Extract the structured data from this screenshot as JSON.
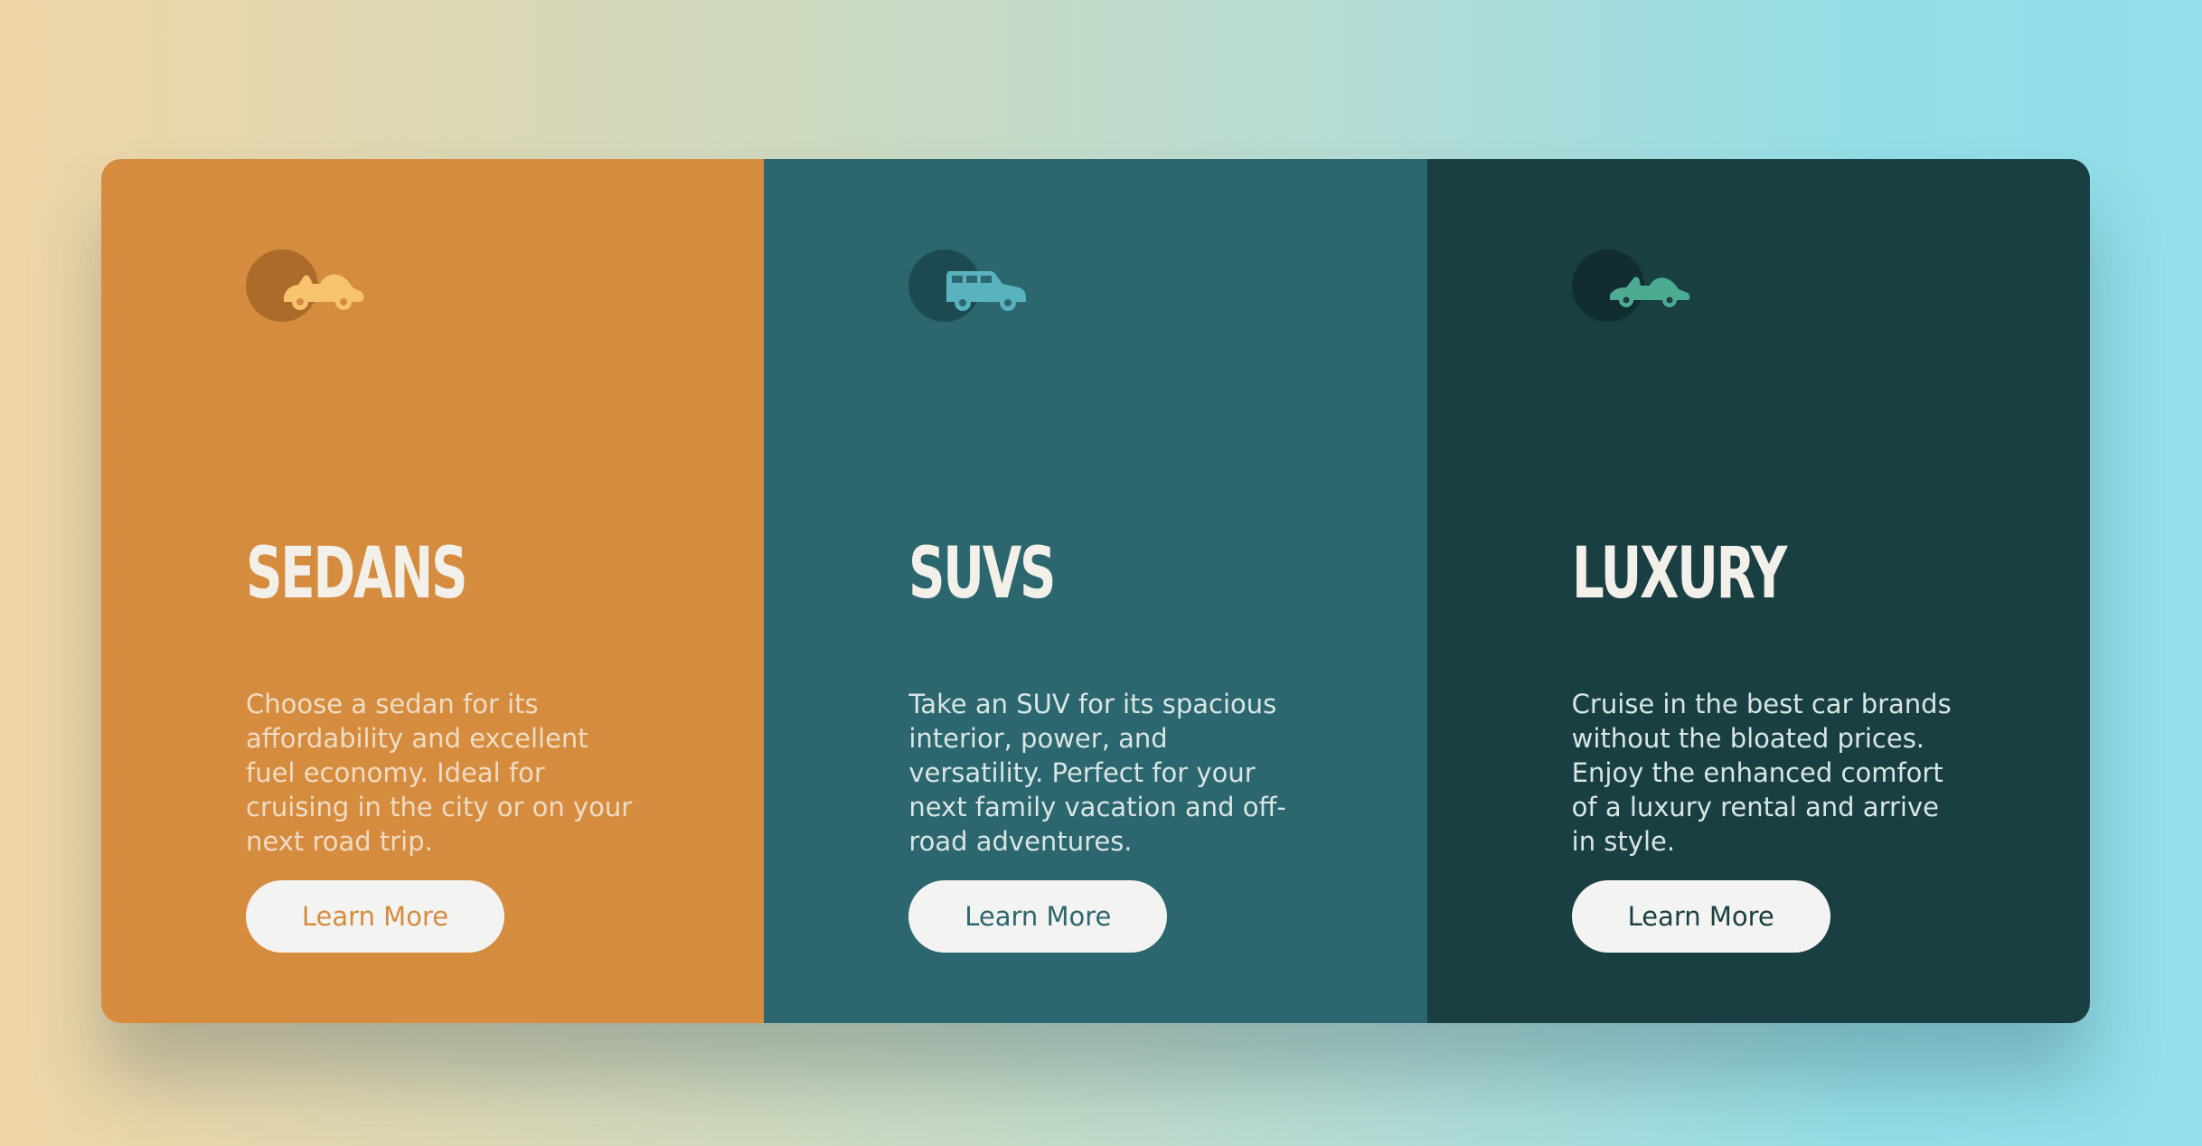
{
  "cards": [
    {
      "id": "sedans",
      "icon": "sedan-car-icon",
      "title": "SEDANS",
      "description": "Choose a sedan for its affordability and excellent fuel economy. Ideal for cruising in the city or on your next road trip.",
      "button_label": "Learn More",
      "background_color": "#d58c3f",
      "icon_color": "#f7c46d"
    },
    {
      "id": "suvs",
      "icon": "suv-car-icon",
      "title": "SUVS",
      "description": "Take an SUV for its spacious interior, power, and versatility. Perfect for your next family vacation and off-road adventures.",
      "button_label": "Learn More",
      "background_color": "#2c666e",
      "icon_color": "#59b3be"
    },
    {
      "id": "luxury",
      "icon": "luxury-car-icon",
      "title": "LUXURY",
      "description": "Cruise in the best car brands without the bloated prices. Enjoy the enhanced comfort of a luxury rental and arrive in style.",
      "button_label": "Learn More",
      "background_color": "#1a3f42",
      "icon_color": "#4dab92"
    }
  ]
}
